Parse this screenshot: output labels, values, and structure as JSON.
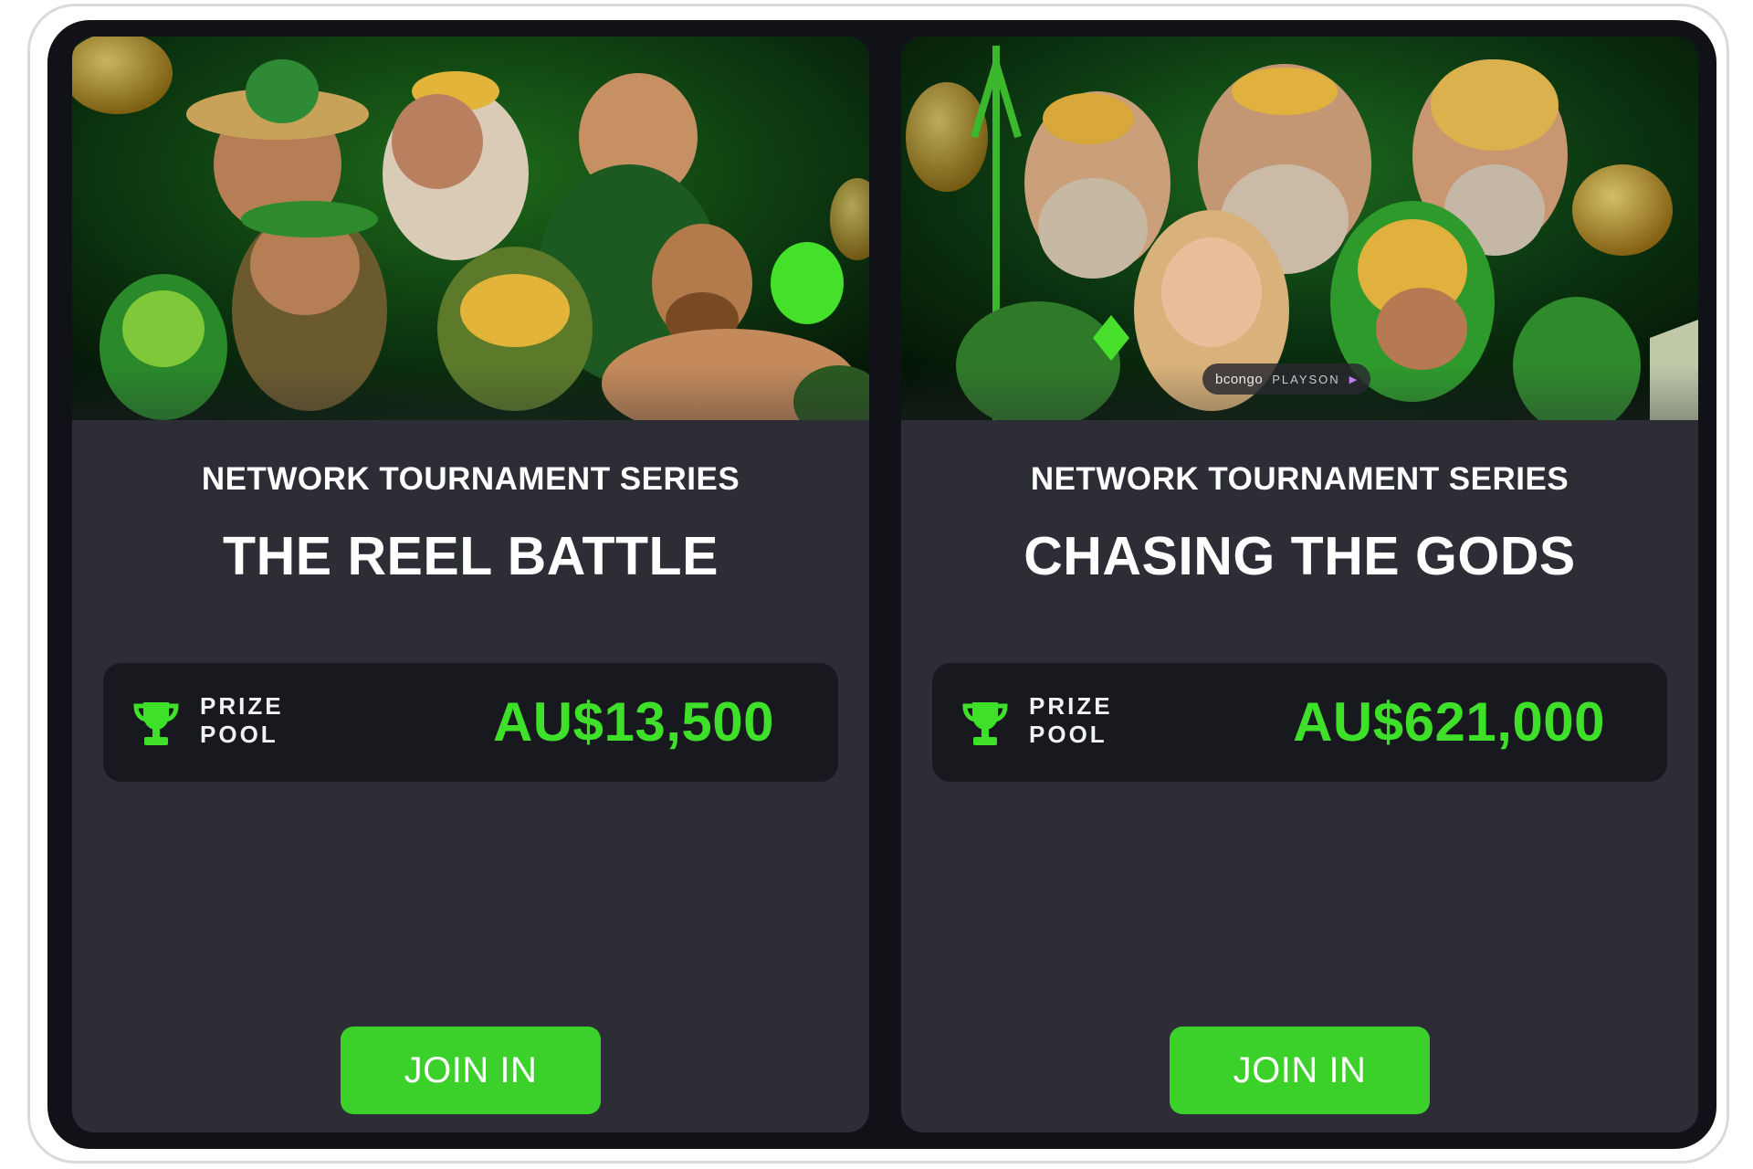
{
  "cards": [
    {
      "series_label": "NETWORK TOURNAMENT SERIES",
      "title": "THE REEL BATTLE",
      "prize_label_line1": "PRIZE",
      "prize_label_line2": "POOL",
      "prize_amount": "AU$13,500",
      "cta_label": "JOIN IN",
      "icon": "trophy-icon"
    },
    {
      "series_label": "NETWORK TOURNAMENT SERIES",
      "title": "CHASING THE GODS",
      "prize_label_line1": "PRIZE",
      "prize_label_line2": "POOL",
      "prize_amount": "AU$621,000",
      "cta_label": "JOIN IN",
      "icon": "trophy-icon",
      "provider_logos": [
        "bcongo",
        "PLAYSON"
      ]
    }
  ],
  "colors": {
    "background": "#111217",
    "card": "#2c2d35",
    "prize_box": "#18191e",
    "accent_green": "#3ee02a",
    "button_green": "#3bd12a"
  }
}
